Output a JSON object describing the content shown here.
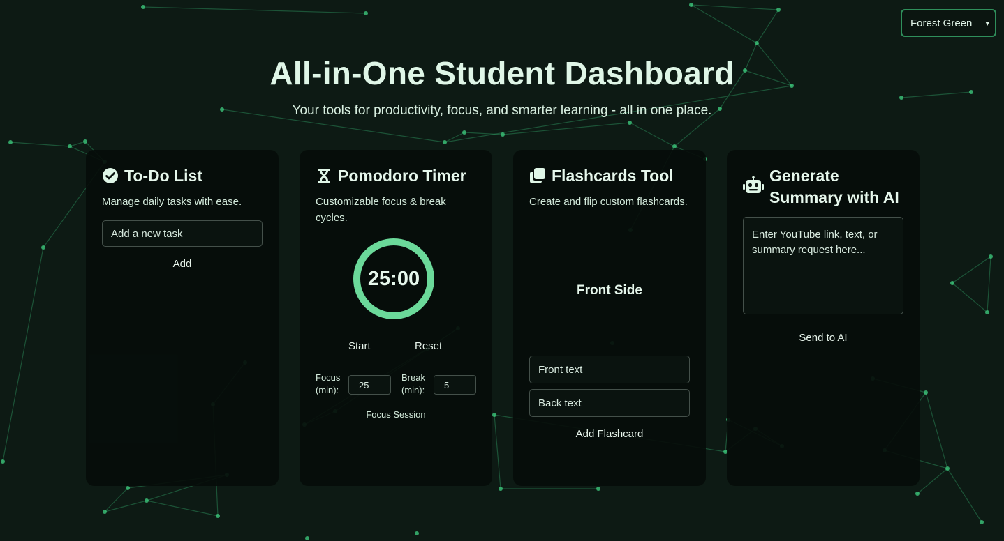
{
  "theme": {
    "selected": "Forest Green",
    "accent": "#6bd99a",
    "background": "#0d1a14",
    "card": "#060d0a"
  },
  "header": {
    "title": "All-in-One Student Dashboard",
    "subtitle": "Your tools for productivity, focus, and smarter learning - all in one place."
  },
  "todo": {
    "title": "To-Do List",
    "icon": "check-circle-icon",
    "description": "Manage daily tasks with ease.",
    "task_placeholder": "Add a new task",
    "add_label": "Add"
  },
  "pomodoro": {
    "title": "Pomodoro Timer",
    "icon": "hourglass-icon",
    "description": "Customizable focus & break cycles.",
    "time": "25:00",
    "start_label": "Start",
    "reset_label": "Reset",
    "focus_label": "Focus (min):",
    "focus_value": "25",
    "break_label": "Break (min):",
    "break_value": "5",
    "session": "Focus Session"
  },
  "flashcards": {
    "title": "Flashcards Tool",
    "icon": "copy-icon",
    "description": "Create and flip custom flashcards.",
    "card_front": "Front Side",
    "front_placeholder": "Front text",
    "back_placeholder": "Back text",
    "add_label": "Add Flashcard"
  },
  "ai_summary": {
    "title": "Generate Summary with AI",
    "icon": "robot-icon",
    "placeholder": "Enter YouTube link, text, or summary request here...",
    "send_label": "Send to AI"
  }
}
